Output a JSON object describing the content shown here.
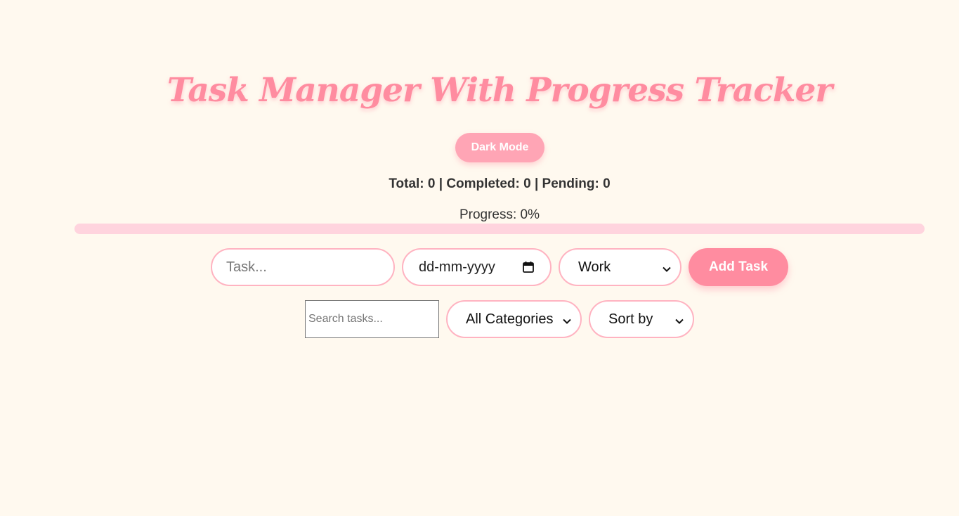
{
  "header": {
    "title": "Task Manager With Progress Tracker",
    "dark_mode_label": "Dark Mode"
  },
  "stats": {
    "summary": "Total: 0 | Completed: 0 | Pending: 0"
  },
  "progress": {
    "label": "Progress: 0%",
    "percent": 0
  },
  "task_form": {
    "task_placeholder": "Task...",
    "date_placeholder": "dd-mm-yyyy",
    "category_selected": "Work",
    "add_label": "Add Task"
  },
  "filters": {
    "search_placeholder": "Search tasks...",
    "category_selected": "All Categories",
    "sort_selected": "Sort by"
  },
  "icons": {
    "calendar": "calendar-icon",
    "chevron": "chevron-down-icon"
  },
  "colors": {
    "background": "#fff9ef",
    "accent": "#ff8ca0",
    "accent_light": "#ffa5b5",
    "track": "#ffd4de",
    "border": "#ffb3c1"
  }
}
